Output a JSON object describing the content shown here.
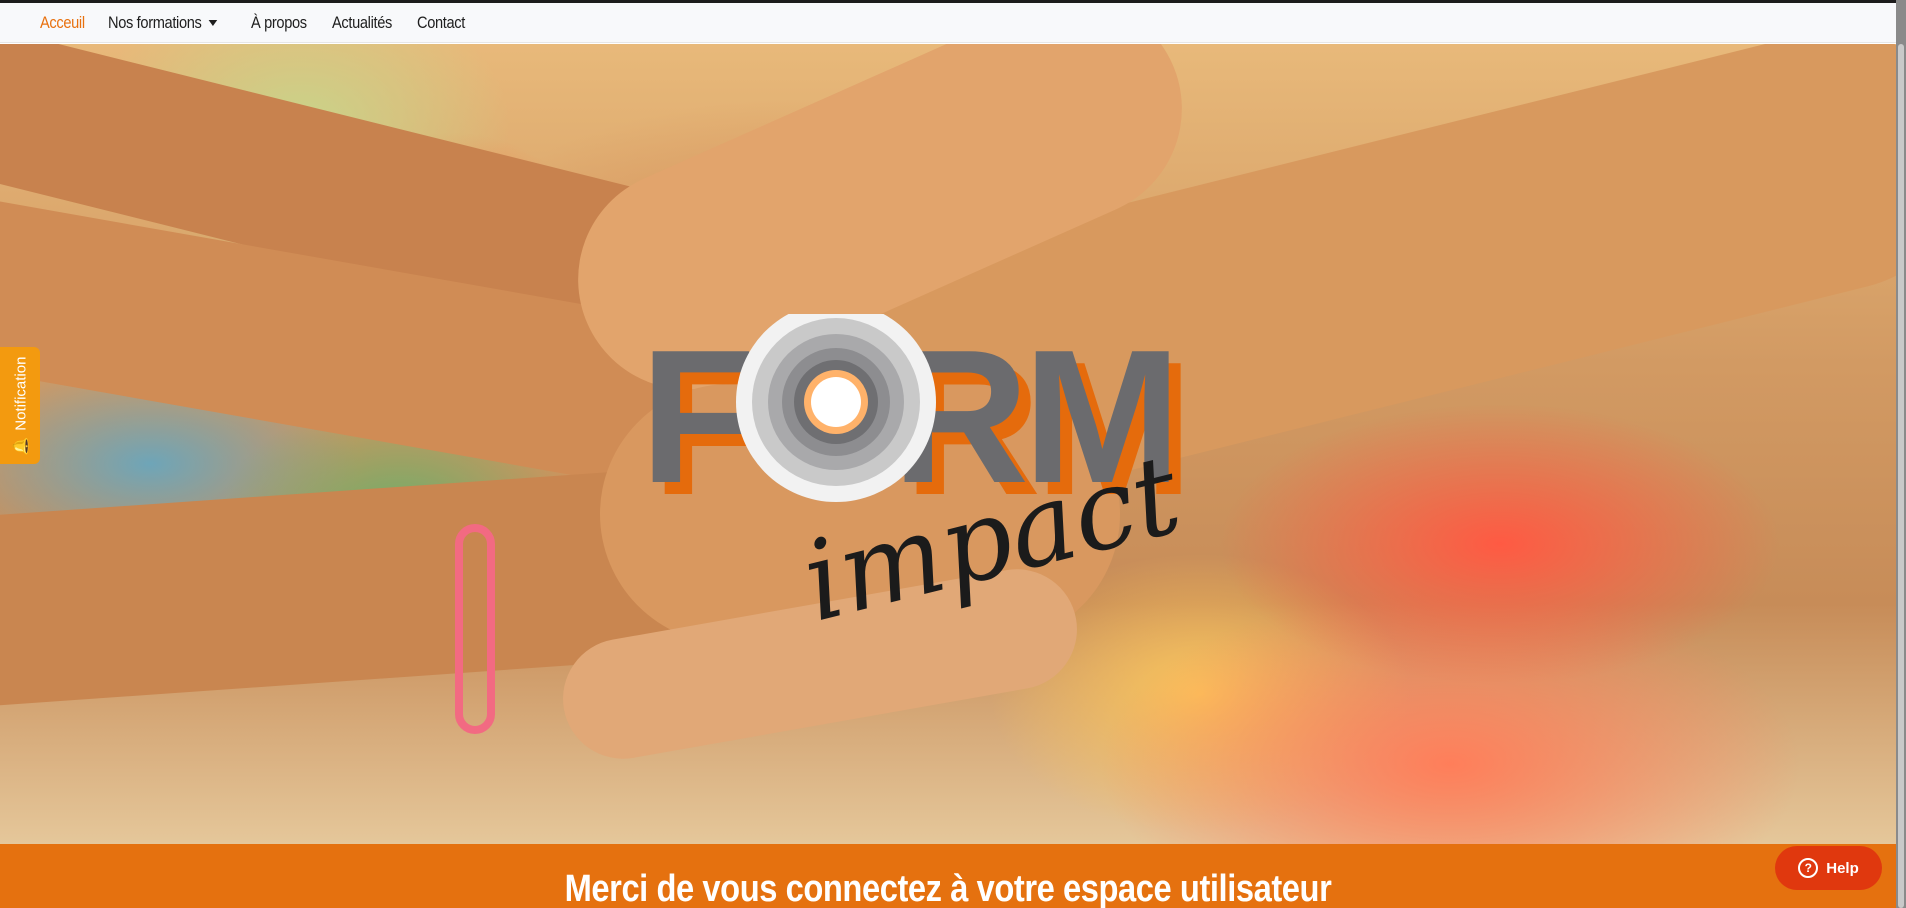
{
  "nav": {
    "items": [
      {
        "label": "Acceuil",
        "active": true
      },
      {
        "label": "Nos formations",
        "dropdown": true
      },
      {
        "label": "À propos"
      },
      {
        "label": "Actualités"
      },
      {
        "label": "Contact"
      }
    ]
  },
  "hero": {
    "logo_primary": "FORM",
    "logo_secondary": "impact"
  },
  "banner": {
    "heading": "Merci de vous connectez à votre espace utilisateur"
  },
  "notification_tab": {
    "label": "Notification",
    "icon": "bell-icon"
  },
  "help_button": {
    "label": "Help",
    "icon": "question-circle-icon"
  },
  "colors": {
    "accent": "#e8710f",
    "banner": "#e5710f",
    "help": "#e0380e",
    "notification": "#f39a0f",
    "logo_gray": "#6b6b6e"
  }
}
